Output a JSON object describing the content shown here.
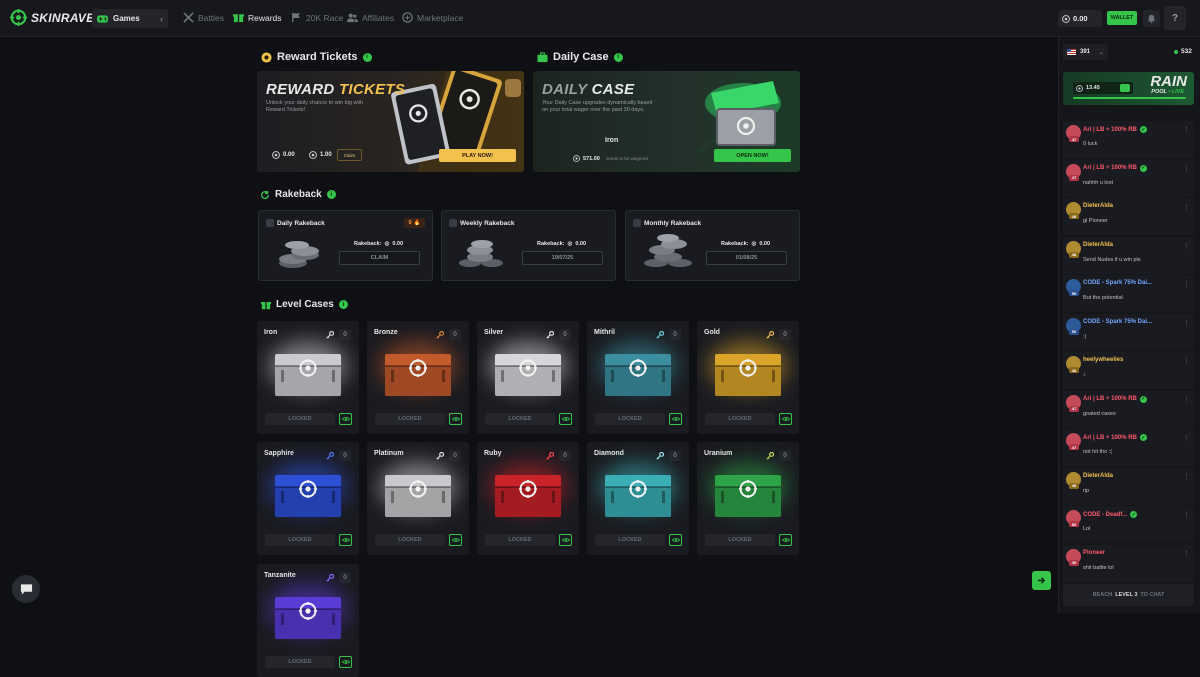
{
  "brand": {
    "name": "SKINRAVE",
    "accent": "#35c54a",
    "gold": "#f2c14e"
  },
  "topbar": {
    "games_label": "Games",
    "nav": [
      {
        "label": "Battles",
        "icon": "swords-icon",
        "active": false
      },
      {
        "label": "Rewards",
        "icon": "gift-icon",
        "active": true
      },
      {
        "label": "20K Race",
        "icon": "flag-icon",
        "active": false
      },
      {
        "label": "Affiliates",
        "icon": "users-icon",
        "active": false
      },
      {
        "label": "Marketplace",
        "icon": "store-icon",
        "active": false
      }
    ],
    "balance": "0.00",
    "wallet_label": "WALLET"
  },
  "reward_tickets": {
    "heading": "Reward Tickets",
    "title_a": "REWARD",
    "title_b": "TICKETS",
    "description": "Unlock your daily chance to win big with Reward Tickets!",
    "balance_a": "0.00",
    "balance_b": "1.00",
    "claim_label": "Claim",
    "play_label": "PLAY NOW!"
  },
  "daily_case": {
    "heading": "Daily Case",
    "title_a": "DAILY",
    "title_b": "CASE",
    "description": "Your Daily Case upgrades dynamically based on your total wager over the past 30 days.",
    "tier": "Iron",
    "wager_needed": "571.00",
    "wager_note": "needs to be wagered",
    "open_label": "OPEN NOW!"
  },
  "rakeback": {
    "heading": "Rakeback",
    "cards": [
      {
        "title": "Daily Rakeback",
        "label": "Rakeback:",
        "amount": "0.00",
        "button": "CLAIM",
        "streak": "0"
      },
      {
        "title": "Weekly Rakeback",
        "label": "Rakeback:",
        "amount": "0.00",
        "button": "19/07/25"
      },
      {
        "title": "Monthly Rakeback",
        "label": "Rakeback:",
        "amount": "0.00",
        "button": "01/08/25"
      }
    ]
  },
  "level_cases": {
    "heading": "Level Cases",
    "locked_label": "LOCKED",
    "cases": [
      {
        "name": "Iron",
        "keys": "0",
        "color": "#c9cbd0",
        "key_color": "#d8d8d8"
      },
      {
        "name": "Bronze",
        "keys": "0",
        "color": "#c25a2c",
        "key_color": "#d9853f"
      },
      {
        "name": "Silver",
        "keys": "0",
        "color": "#d6d7db",
        "key_color": "#e6e6e6"
      },
      {
        "name": "Mithril",
        "keys": "0",
        "color": "#3b8fa0",
        "key_color": "#6fd1e0"
      },
      {
        "name": "Gold",
        "keys": "0",
        "color": "#d9a429",
        "key_color": "#f2c14e"
      },
      {
        "name": "Sapphire",
        "keys": "0",
        "color": "#2d4fd6",
        "key_color": "#5878ff"
      },
      {
        "name": "Platinum",
        "keys": "0",
        "color": "#c8c9cc",
        "key_color": "#dfe0e4"
      },
      {
        "name": "Ruby",
        "keys": "0",
        "color": "#c82329",
        "key_color": "#ff4d52"
      },
      {
        "name": "Diamond",
        "keys": "0",
        "color": "#3aaeb4",
        "key_color": "#9fe8f0"
      },
      {
        "name": "Uranium",
        "keys": "0",
        "color": "#2fa34a",
        "key_color": "#c8e04a"
      },
      {
        "name": "Tanzanite",
        "keys": "0",
        "color": "#5a3bd6",
        "key_color": "#8a6bff"
      }
    ]
  },
  "chat": {
    "room": "391",
    "online": "532",
    "rain": {
      "amount": "13.45",
      "title": "RAIN",
      "sub_a": "POOL",
      "sub_b": "• LIVE"
    },
    "messages": [
      {
        "user": "Ari | LB + 100% RB",
        "text": "0 luck",
        "verified": true,
        "name_color": "#ff5a6b",
        "avatar": "#c54a5a",
        "level": "47",
        "lvl_color": "#b23546"
      },
      {
        "user": "Ari | LB + 100% RB",
        "text": "nahhh u lost",
        "verified": true,
        "name_color": "#ff5a6b",
        "avatar": "#c54a5a",
        "level": "47",
        "lvl_color": "#b23546"
      },
      {
        "user": "DieterAlda",
        "text": "gl Pioneer",
        "verified": false,
        "name_color": "#f2c14e",
        "avatar": "#b08a30",
        "level": "48",
        "lvl_color": "#8a6a1a"
      },
      {
        "user": "DieterAlda",
        "text": "Send Nudes if u win pls",
        "verified": false,
        "name_color": "#f2c14e",
        "avatar": "#b08a30",
        "level": "48",
        "lvl_color": "#8a6a1a"
      },
      {
        "user": "CODE - Spark 75% Dai...",
        "text": "But the potential",
        "verified": false,
        "name_color": "#6fa8ff",
        "avatar": "#2d5a9a",
        "level": "50",
        "lvl_color": "#2a4f8f"
      },
      {
        "user": "CODE - Spark 75% Dai...",
        "text": ":(",
        "verified": false,
        "name_color": "#6fa8ff",
        "avatar": "#2d5a9a",
        "level": "50",
        "lvl_color": "#2a4f8f"
      },
      {
        "user": "heelywheelies",
        "text": "♪",
        "verified": false,
        "name_color": "#f2c14e",
        "avatar": "#b08a30",
        "level": "46",
        "lvl_color": "#8a6a1a"
      },
      {
        "user": "Ari | LB + 100% RB",
        "text": "goated cases",
        "verified": true,
        "name_color": "#ff5a6b",
        "avatar": "#c54a5a",
        "level": "47",
        "lvl_color": "#b23546"
      },
      {
        "user": "Ari | LB + 100% RB",
        "text": "not hit tho :(",
        "verified": true,
        "name_color": "#ff5a6b",
        "avatar": "#c54a5a",
        "level": "47",
        "lvl_color": "#b23546"
      },
      {
        "user": "DieterAlda",
        "text": "rip",
        "verified": false,
        "name_color": "#f2c14e",
        "avatar": "#b08a30",
        "level": "48",
        "lvl_color": "#8a6a1a"
      },
      {
        "user": "CODE - Deadf...",
        "text": "Lol",
        "verified": true,
        "name_color": "#ff5a6b",
        "avatar": "#c54a5a",
        "level": "52",
        "lvl_color": "#b23546"
      },
      {
        "user": "Pioneer",
        "text": "shit battle lol",
        "verified": false,
        "name_color": "#ff5a6b",
        "avatar": "#c54a5a",
        "level": "49",
        "lvl_color": "#b23546"
      }
    ],
    "reach_a": "REACH",
    "reach_b": "LEVEL 3",
    "reach_c": "TO CHAT"
  }
}
